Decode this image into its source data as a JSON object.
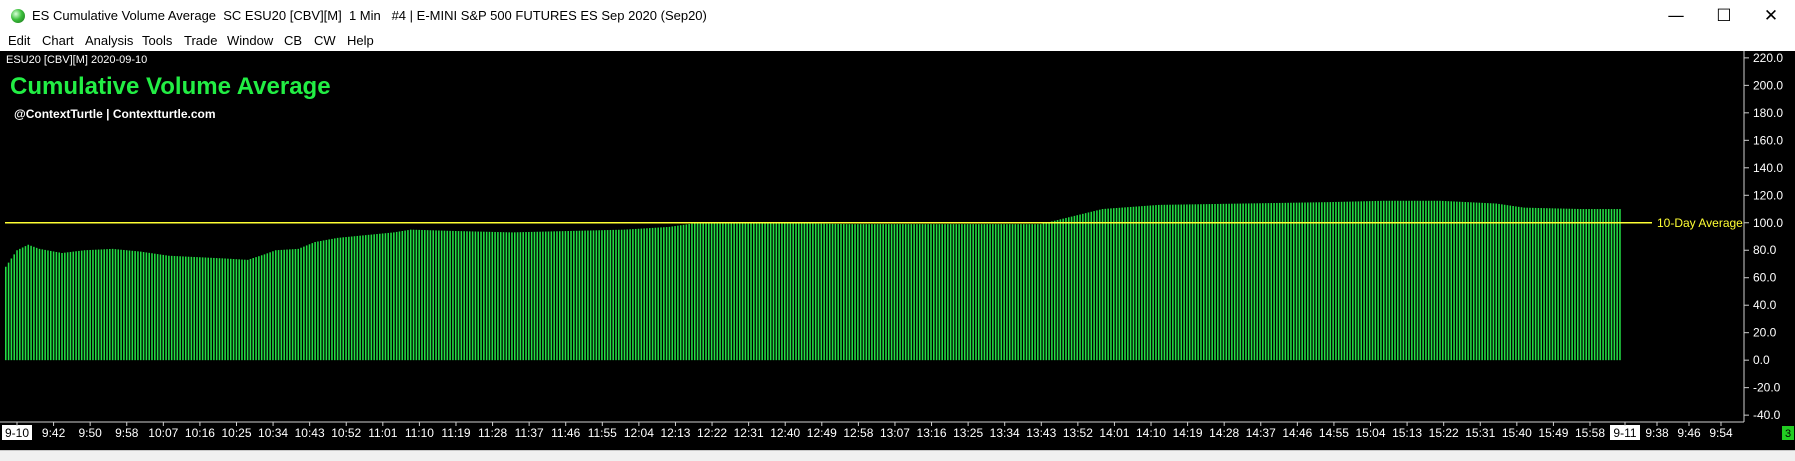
{
  "window": {
    "title": "ES Cumulative Volume Average  SC ESU20 [CBV][M]  1 Min   #4 | E-MINI S&P 500 FUTURES ES Sep 2020 (Sep20)",
    "min_glyph": "—",
    "max_glyph": "☐",
    "close_glyph": "✕"
  },
  "menu": [
    "Edit",
    "Chart",
    "Analysis",
    "Tools",
    "Trade",
    "Window",
    "CB",
    "CW",
    "Help"
  ],
  "chart": {
    "symbol_header": "ESU20 [CBV][M] 2020-09-10",
    "heading": "Cumulative Volume Average",
    "byline": "@ContextTurtle | Contextturtle.com",
    "reference_label": "10-Day Average",
    "corner_badge": "3",
    "colors": {
      "background": "#000000",
      "bars": "#22dd44",
      "reference_line": "#ffff33",
      "heading": "#22ee44",
      "text": "#ffffff",
      "reference_label": "#ffff33",
      "badge": "#22cc22"
    }
  },
  "chart_data": {
    "type": "bar",
    "reference_line": 100,
    "ylim": [
      -45,
      225
    ],
    "y_ticks": [
      220,
      200,
      180,
      160,
      140,
      120,
      100,
      80,
      60,
      40,
      20,
      0,
      -20,
      -40
    ],
    "y_tick_labels": [
      "220.0",
      "200.0",
      "180.0",
      "160.0",
      "140.0",
      "120.0",
      "100.0",
      "80.0",
      "60.0",
      "40.0",
      "20.0",
      "0.0",
      "-20.0",
      "-40.0"
    ],
    "x_tick_labels": [
      "9-10",
      "9:42",
      "9:50",
      "9:58",
      "10:07",
      "10:16",
      "10:25",
      "10:34",
      "10:43",
      "10:52",
      "11:01",
      "11:10",
      "11:19",
      "11:28",
      "11:37",
      "11:46",
      "11:55",
      "12:04",
      "12:13",
      "12:22",
      "12:31",
      "12:40",
      "12:49",
      "12:58",
      "13:07",
      "13:16",
      "13:25",
      "13:34",
      "13:43",
      "13:52",
      "14:01",
      "14:10",
      "14:19",
      "14:28",
      "14:37",
      "14:46",
      "14:55",
      "15:04",
      "15:13",
      "15:22",
      "15:31",
      "15:40",
      "15:49",
      "15:58",
      "9-11",
      "9:38",
      "9:46",
      "9:54"
    ],
    "highlighted_x_labels": [
      "9-10",
      "9-11"
    ],
    "keyframes": [
      [
        0,
        68
      ],
      [
        4,
        80
      ],
      [
        8,
        84
      ],
      [
        12,
        81
      ],
      [
        20,
        78
      ],
      [
        28,
        80
      ],
      [
        38,
        81
      ],
      [
        48,
        79
      ],
      [
        58,
        76
      ],
      [
        68,
        75
      ],
      [
        78,
        74
      ],
      [
        86,
        73
      ],
      [
        92,
        77
      ],
      [
        96,
        80
      ],
      [
        104,
        81
      ],
      [
        110,
        86
      ],
      [
        118,
        89
      ],
      [
        128,
        91
      ],
      [
        138,
        93
      ],
      [
        144,
        95
      ],
      [
        160,
        94
      ],
      [
        180,
        93
      ],
      [
        200,
        94
      ],
      [
        220,
        95
      ],
      [
        236,
        97
      ],
      [
        246,
        100
      ],
      [
        270,
        100
      ],
      [
        300,
        99
      ],
      [
        340,
        99
      ],
      [
        368,
        99
      ],
      [
        380,
        105
      ],
      [
        390,
        110
      ],
      [
        410,
        113
      ],
      [
        440,
        114
      ],
      [
        470,
        115
      ],
      [
        490,
        116
      ],
      [
        510,
        116
      ],
      [
        530,
        114
      ],
      [
        540,
        111
      ],
      [
        560,
        110
      ],
      [
        574,
        110
      ]
    ],
    "bar_count": 575
  }
}
